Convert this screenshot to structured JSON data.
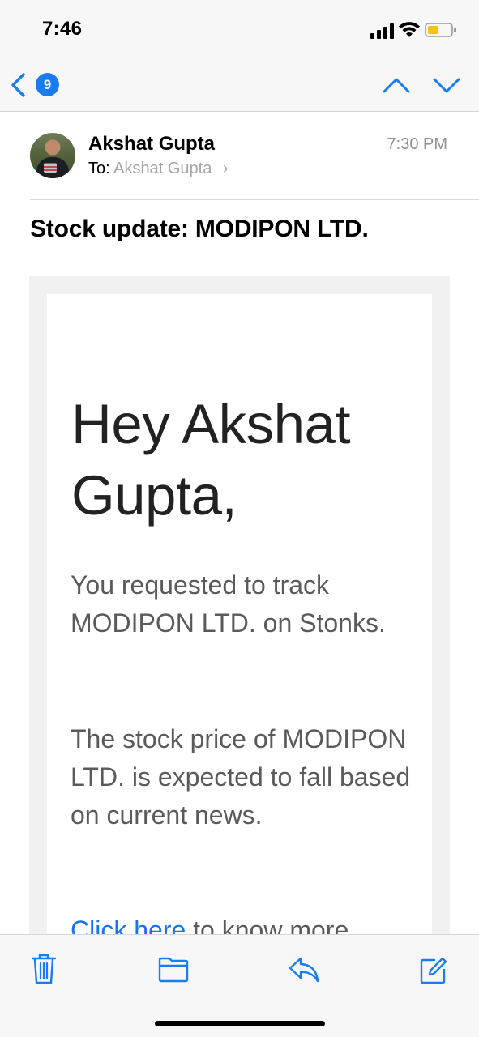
{
  "status_bar": {
    "time": "7:46",
    "battery_color": "#f2c40f"
  },
  "nav": {
    "unread_count": "9",
    "accent_color": "#1a7cf5",
    "back_icon": "chevron-left-icon",
    "up_icon": "chevron-up-icon",
    "down_icon": "chevron-down-icon"
  },
  "message": {
    "sender": "Akshat Gupta",
    "to_label": "To:",
    "recipient": "Akshat Gupta",
    "recipient_chevron": "›",
    "time": "7:30 PM",
    "subject": "Stock update: MODIPON LTD."
  },
  "body": {
    "greeting": "Hey Akshat Gupta,",
    "paragraph1": "You requested to track MODIPON LTD. on Stonks.",
    "paragraph2": "The stock price of MODIPON LTD. is expected to fall based on current news.",
    "link_text": "Click here",
    "link_suffix": " to know more."
  },
  "toolbar": {
    "icons": [
      "trash-icon",
      "folder-icon",
      "reply-icon",
      "compose-icon"
    ]
  }
}
